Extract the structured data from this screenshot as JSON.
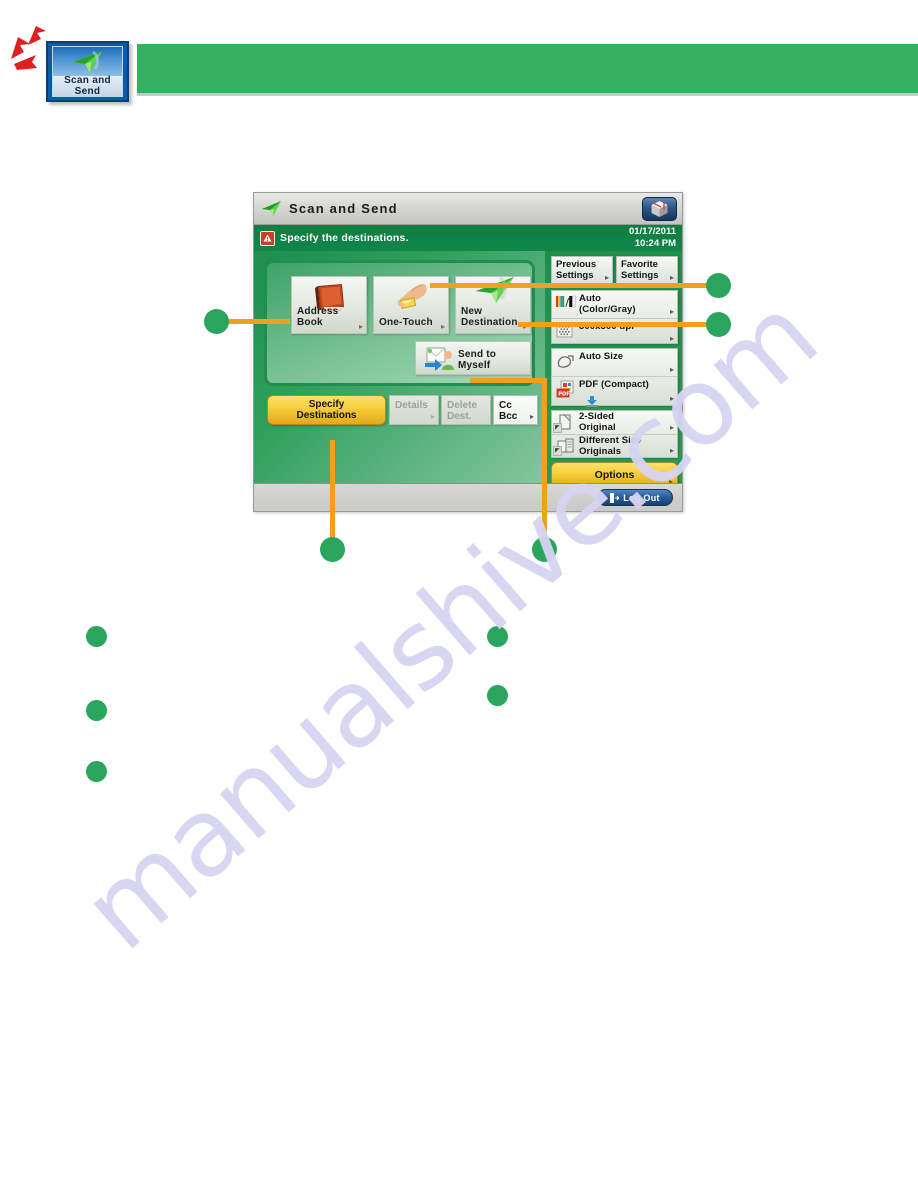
{
  "page": {
    "watermark": "manualshive.com"
  },
  "tab": {
    "label_line1": "Scan  and",
    "label_line2": "Send",
    "icon": "paper-plane-icon",
    "attention_marks": "red-flash-marks"
  },
  "banner": {
    "color": "#35b162",
    "text": ""
  },
  "panel": {
    "title": "Scan  and  Send",
    "title_icon": "paper-plane-icon",
    "cube_button_icon": "3d-cube-icon",
    "status": {
      "icon": "alert-triangle-icon",
      "message": "Specify the destinations.",
      "date": "01/17/2011",
      "time": "10:24 PM"
    },
    "destinations": {
      "buttons": [
        {
          "label": "Address Book",
          "icon": "address-book-icon",
          "arrow": "▸"
        },
        {
          "label": "One-Touch",
          "icon": "hand-card-icon",
          "arrow": "▸"
        },
        {
          "label_line1": "New",
          "label_line2": "Destination",
          "icon": "paper-plane-icon",
          "arrow": "▸"
        }
      ],
      "send_to_myself": {
        "label_line1": "Send to",
        "label_line2": "Myself",
        "icon": "send-to-myself-icon"
      }
    },
    "action_row": {
      "specify_line1": "Specify",
      "specify_line2": "Destinations",
      "details_line1": "Details",
      "details_line2": "",
      "delete_line1": "Delete",
      "delete_line2": "Dest.",
      "ccbcc_line1": "Cc",
      "ccbcc_line2": "Bcc",
      "arrow": "▸"
    },
    "settings": {
      "previous_line1": "Previous",
      "previous_line2": "Settings",
      "favorite_line1": "Favorite",
      "favorite_line2": "Settings",
      "rows": [
        {
          "line1": "Auto",
          "line2": "(Color/Gray)",
          "icon": "color-mode-icon",
          "arrow": "▸"
        },
        {
          "line1": "300x300 dpi",
          "line2": "",
          "icon": "resolution-dots-icon",
          "arrow": "▸"
        },
        {
          "line1": "Auto Size",
          "line2": "",
          "icon": "scan-size-icon",
          "arrow": "▸"
        },
        {
          "line1": "PDF (Compact)",
          "line2": "",
          "icon": "pdf-file-icon",
          "arrow": "▸"
        },
        {
          "line1": "2-Sided",
          "line2": "Original",
          "icon": "two-sided-icon",
          "arrow": "▸",
          "badge": "◤"
        },
        {
          "line1": "Different Size",
          "line2": "Originals",
          "icon": "different-size-icon",
          "arrow": "▸",
          "badge": "◤"
        }
      ],
      "options_label": "Options",
      "options_arrow": "▸"
    },
    "bottom": {
      "logout_label": "Log Out",
      "logout_icon": "logout-icon"
    }
  },
  "callouts": {
    "color": "#2aa55e",
    "leader_color": "#f0a01e",
    "markers": [
      {
        "name": "callout-address-book",
        "label": ""
      },
      {
        "name": "callout-settings-top",
        "label": ""
      },
      {
        "name": "callout-settings-resolution",
        "label": ""
      },
      {
        "name": "callout-specify-destinations",
        "label": ""
      },
      {
        "name": "callout-send-to-myself",
        "label": ""
      }
    ],
    "legend": [
      {
        "name": "legend-marker-1",
        "label": ""
      },
      {
        "name": "legend-marker-2",
        "label": ""
      },
      {
        "name": "legend-marker-3",
        "label": ""
      },
      {
        "name": "legend-marker-4",
        "label": ""
      },
      {
        "name": "legend-marker-5",
        "label": ""
      }
    ]
  }
}
